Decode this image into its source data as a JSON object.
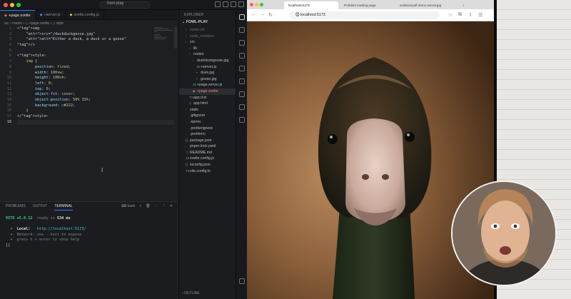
{
  "vscode": {
    "window_title": "fowl-play",
    "tabs": [
      {
        "icon": "svelte",
        "label": "+page.svelte",
        "active": true
      },
      {
        "icon": "ts",
        "label": "+server.js",
        "active": false
      },
      {
        "icon": "js",
        "label": "svelte.config.js",
        "active": false
      }
    ],
    "breadcrumb": "src › routes › ◇ +page.svelte › ◇ style",
    "code_lines": [
      "<img",
      "    src=\"/duckduckgoose.jpg\"",
      "    alt=\"Either a duck, a duck or a goose\"",
      "/>",
      "",
      "<style>",
      "    img {",
      "        position: fixed;",
      "        width: 100vw;",
      "        height: 100vh;",
      "        left: 0;",
      "        top: 0;",
      "        object-fit: cover;",
      "        object-position: 50% 33%;",
      "        background: ▢#222;",
      "    }",
      "</style>",
      ""
    ],
    "line_numbers": [
      "1",
      "2",
      "3",
      "4",
      "5",
      "6",
      "7",
      "8",
      "9",
      "10",
      "11",
      "12",
      "13",
      "14",
      "15",
      "16",
      "17",
      "18"
    ],
    "panel": {
      "tabs": [
        "PROBLEMS",
        "OUTPUT",
        "TERMINAL"
      ],
      "active_tab": "TERMINAL",
      "shell": "bash",
      "terminal": {
        "vite": "VITE v5.0.12",
        "ready": "ready in",
        "ready_ms": "534 ms",
        "local_label": "Local:",
        "local_url": "http://localhost:5173/",
        "network_line": "Network: use --host to expose",
        "help_line": "press h + enter to show help",
        "prompt": "[]"
      }
    },
    "explorer": {
      "header": "EXPLORER",
      "project": "FOWL-PLAY",
      "items": [
        {
          "label": "svelte-kit",
          "depth": 1,
          "type": "folder",
          "dim": true
        },
        {
          "label": "node_modules",
          "depth": 1,
          "type": "folder",
          "dim": true
        },
        {
          "label": "src",
          "depth": 1,
          "type": "folder",
          "dim": false
        },
        {
          "label": "lib",
          "depth": 2,
          "type": "folder",
          "dim": false
        },
        {
          "label": "routes",
          "depth": 2,
          "type": "folder",
          "dim": false
        },
        {
          "label": "duckduckgoose.jpg",
          "depth": 3,
          "type": "folder",
          "dim": false
        },
        {
          "label": "+server.js",
          "depth": 4,
          "type": "js",
          "dim": false
        },
        {
          "label": "duck.jpg",
          "depth": 4,
          "type": "img",
          "dim": false
        },
        {
          "label": "goose.jpg",
          "depth": 4,
          "type": "img",
          "dim": false
        },
        {
          "label": "+page.server.js",
          "depth": 3,
          "type": "js",
          "dim": false
        },
        {
          "label": "+page.svelte",
          "depth": 3,
          "type": "svelte",
          "dim": false,
          "highlight": true
        },
        {
          "label": "app.d.ts",
          "depth": 2,
          "type": "ts",
          "dim": false
        },
        {
          "label": "app.html",
          "depth": 2,
          "type": "html",
          "dim": false
        },
        {
          "label": "static",
          "depth": 1,
          "type": "folder",
          "dim": false
        },
        {
          "label": ".gitignore",
          "depth": 1,
          "type": "file",
          "dim": false
        },
        {
          "label": ".npmrc",
          "depth": 1,
          "type": "file",
          "dim": false
        },
        {
          "label": ".prettierignore",
          "depth": 1,
          "type": "file",
          "dim": false
        },
        {
          "label": ".prettierrc",
          "depth": 1,
          "type": "file",
          "dim": false
        },
        {
          "label": "package.json",
          "depth": 1,
          "type": "json",
          "dim": false
        },
        {
          "label": "pnpm-lock.yaml",
          "depth": 1,
          "type": "file",
          "dim": false
        },
        {
          "label": "README.md",
          "depth": 1,
          "type": "md",
          "dim": false
        },
        {
          "label": "svelte.config.js",
          "depth": 1,
          "type": "js",
          "dim": false
        },
        {
          "label": "tsconfig.json",
          "depth": 1,
          "type": "json",
          "dim": false
        },
        {
          "label": "vite.config.ts",
          "depth": 1,
          "type": "ts",
          "dim": false
        }
      ],
      "outline_label": "OUTLINE"
    }
  },
  "browser": {
    "tabs": [
      "localhost:5173",
      "Problem loading page",
      "svelteoit.pdf demo serval.jpg"
    ],
    "url": "localhost:5173",
    "new_tab": "+"
  },
  "colors": {
    "editor_bg": "#1e1f22",
    "accent": "#3a7cff",
    "vite_green": "#3cd28a",
    "svelte_orange": "#ff6a3d"
  }
}
